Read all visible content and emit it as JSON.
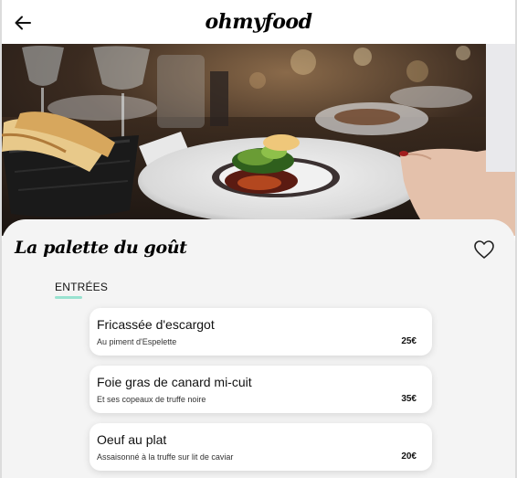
{
  "header": {
    "logo": "ohmyfood",
    "back_icon": "arrow-left-icon"
  },
  "restaurant": {
    "name": "La palette du goût",
    "like_icon": "heart-outline-icon"
  },
  "menu": {
    "section_label": "ENTRÉES",
    "dishes": [
      {
        "name": "Fricassée d'escargot",
        "description": "Au piment d'Espelette",
        "price": "25€"
      },
      {
        "name": "Foie gras de canard mi-cuit",
        "description": "Et ses copeaux de truffe noire",
        "price": "35€"
      },
      {
        "name": "Oeuf au plat",
        "description": "Assaisonné à la truffe sur lit de caviar",
        "price": "20€"
      }
    ]
  },
  "colors": {
    "accent": "#99e2d0",
    "sheet_background": "#f4f4f4",
    "card_background": "#ffffff"
  }
}
